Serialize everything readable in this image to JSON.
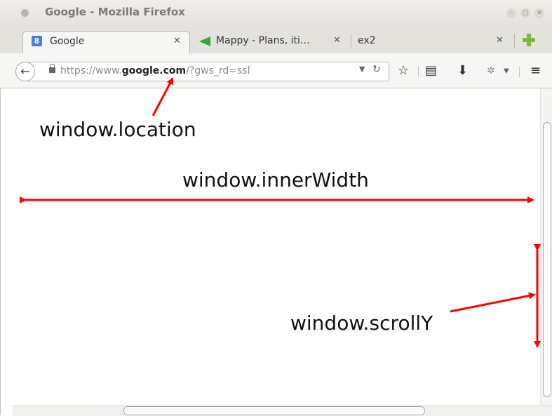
{
  "window": {
    "title": "Google - Mozilla Firefox"
  },
  "tabs": [
    {
      "label": "Google",
      "icon": "google-favicon",
      "active": true
    },
    {
      "label": "Mappy - Plans, iti…",
      "icon": "mappy-favicon",
      "active": false
    },
    {
      "label": "ex2",
      "icon": "",
      "active": false
    }
  ],
  "tab_close_glyph": "✕",
  "navbar": {
    "url_prefix": "https://www.",
    "url_domain": "google.com",
    "url_suffix": "/?gws_rd=ssl"
  },
  "annotations": {
    "location": "window.location",
    "inner_width": "window.innerWidth",
    "scroll_y": "window.scrollY"
  },
  "colors": {
    "arrow": "#ff0000",
    "accent_tab_icon": "#4a7fd8",
    "newtab_plus": "#7ab83e"
  }
}
